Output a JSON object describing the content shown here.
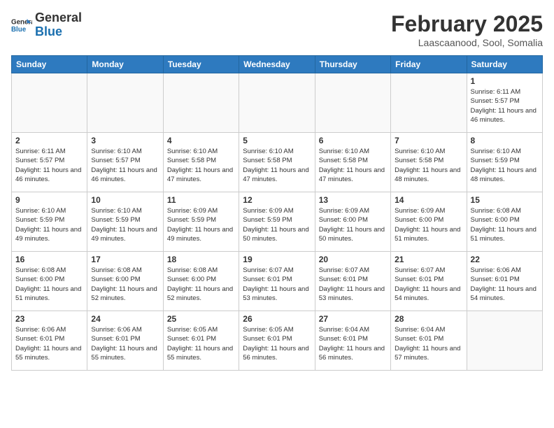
{
  "logo": {
    "general": "General",
    "blue": "Blue"
  },
  "header": {
    "month": "February 2025",
    "location": "Laascaanood, Sool, Somalia"
  },
  "days_of_week": [
    "Sunday",
    "Monday",
    "Tuesday",
    "Wednesday",
    "Thursday",
    "Friday",
    "Saturday"
  ],
  "weeks": [
    [
      {
        "day": "",
        "info": ""
      },
      {
        "day": "",
        "info": ""
      },
      {
        "day": "",
        "info": ""
      },
      {
        "day": "",
        "info": ""
      },
      {
        "day": "",
        "info": ""
      },
      {
        "day": "",
        "info": ""
      },
      {
        "day": "1",
        "info": "Sunrise: 6:11 AM\nSunset: 5:57 PM\nDaylight: 11 hours and 46 minutes."
      }
    ],
    [
      {
        "day": "2",
        "info": "Sunrise: 6:11 AM\nSunset: 5:57 PM\nDaylight: 11 hours and 46 minutes."
      },
      {
        "day": "3",
        "info": "Sunrise: 6:10 AM\nSunset: 5:57 PM\nDaylight: 11 hours and 46 minutes."
      },
      {
        "day": "4",
        "info": "Sunrise: 6:10 AM\nSunset: 5:58 PM\nDaylight: 11 hours and 47 minutes."
      },
      {
        "day": "5",
        "info": "Sunrise: 6:10 AM\nSunset: 5:58 PM\nDaylight: 11 hours and 47 minutes."
      },
      {
        "day": "6",
        "info": "Sunrise: 6:10 AM\nSunset: 5:58 PM\nDaylight: 11 hours and 47 minutes."
      },
      {
        "day": "7",
        "info": "Sunrise: 6:10 AM\nSunset: 5:58 PM\nDaylight: 11 hours and 48 minutes."
      },
      {
        "day": "8",
        "info": "Sunrise: 6:10 AM\nSunset: 5:59 PM\nDaylight: 11 hours and 48 minutes."
      }
    ],
    [
      {
        "day": "9",
        "info": "Sunrise: 6:10 AM\nSunset: 5:59 PM\nDaylight: 11 hours and 49 minutes."
      },
      {
        "day": "10",
        "info": "Sunrise: 6:10 AM\nSunset: 5:59 PM\nDaylight: 11 hours and 49 minutes."
      },
      {
        "day": "11",
        "info": "Sunrise: 6:09 AM\nSunset: 5:59 PM\nDaylight: 11 hours and 49 minutes."
      },
      {
        "day": "12",
        "info": "Sunrise: 6:09 AM\nSunset: 5:59 PM\nDaylight: 11 hours and 50 minutes."
      },
      {
        "day": "13",
        "info": "Sunrise: 6:09 AM\nSunset: 6:00 PM\nDaylight: 11 hours and 50 minutes."
      },
      {
        "day": "14",
        "info": "Sunrise: 6:09 AM\nSunset: 6:00 PM\nDaylight: 11 hours and 51 minutes."
      },
      {
        "day": "15",
        "info": "Sunrise: 6:08 AM\nSunset: 6:00 PM\nDaylight: 11 hours and 51 minutes."
      }
    ],
    [
      {
        "day": "16",
        "info": "Sunrise: 6:08 AM\nSunset: 6:00 PM\nDaylight: 11 hours and 51 minutes."
      },
      {
        "day": "17",
        "info": "Sunrise: 6:08 AM\nSunset: 6:00 PM\nDaylight: 11 hours and 52 minutes."
      },
      {
        "day": "18",
        "info": "Sunrise: 6:08 AM\nSunset: 6:00 PM\nDaylight: 11 hours and 52 minutes."
      },
      {
        "day": "19",
        "info": "Sunrise: 6:07 AM\nSunset: 6:01 PM\nDaylight: 11 hours and 53 minutes."
      },
      {
        "day": "20",
        "info": "Sunrise: 6:07 AM\nSunset: 6:01 PM\nDaylight: 11 hours and 53 minutes."
      },
      {
        "day": "21",
        "info": "Sunrise: 6:07 AM\nSunset: 6:01 PM\nDaylight: 11 hours and 54 minutes."
      },
      {
        "day": "22",
        "info": "Sunrise: 6:06 AM\nSunset: 6:01 PM\nDaylight: 11 hours and 54 minutes."
      }
    ],
    [
      {
        "day": "23",
        "info": "Sunrise: 6:06 AM\nSunset: 6:01 PM\nDaylight: 11 hours and 55 minutes."
      },
      {
        "day": "24",
        "info": "Sunrise: 6:06 AM\nSunset: 6:01 PM\nDaylight: 11 hours and 55 minutes."
      },
      {
        "day": "25",
        "info": "Sunrise: 6:05 AM\nSunset: 6:01 PM\nDaylight: 11 hours and 55 minutes."
      },
      {
        "day": "26",
        "info": "Sunrise: 6:05 AM\nSunset: 6:01 PM\nDaylight: 11 hours and 56 minutes."
      },
      {
        "day": "27",
        "info": "Sunrise: 6:04 AM\nSunset: 6:01 PM\nDaylight: 11 hours and 56 minutes."
      },
      {
        "day": "28",
        "info": "Sunrise: 6:04 AM\nSunset: 6:01 PM\nDaylight: 11 hours and 57 minutes."
      },
      {
        "day": "",
        "info": ""
      }
    ]
  ]
}
